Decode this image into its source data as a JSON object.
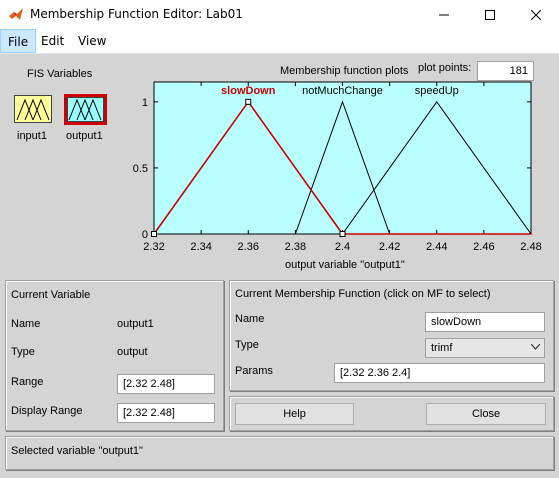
{
  "window": {
    "title": "Membership Function Editor: Lab01"
  },
  "menu": [
    {
      "label": "File"
    },
    {
      "label": "Edit"
    },
    {
      "label": "View"
    }
  ],
  "fis": {
    "heading": "FIS Variables",
    "input_label": "input1",
    "output_label": "output1"
  },
  "plot": {
    "title": "Membership function plots",
    "points_label": "plot points:",
    "points_value": "181",
    "xlabel": "output variable \"output1\"",
    "highlight_color": "#cc0000",
    "background_color": "#b9ffff"
  },
  "chart_data": {
    "type": "line",
    "xlim": [
      2.32,
      2.48
    ],
    "ylim": [
      0,
      1.15
    ],
    "x_ticks": [
      "2.32",
      "2.34",
      "2.36",
      "2.38",
      "2.4",
      "2.42",
      "2.44",
      "2.46",
      "2.48"
    ],
    "y_ticks": [
      "0",
      "0.5",
      "1"
    ],
    "series": [
      {
        "name": "slowDown",
        "x": [
          2.32,
          2.36,
          2.4
        ],
        "y": [
          0,
          1,
          0
        ],
        "selected": true
      },
      {
        "name": "notMuchChange",
        "x": [
          2.38,
          2.4,
          2.42
        ],
        "y": [
          0,
          1,
          0
        ],
        "selected": false
      },
      {
        "name": "speedUp",
        "x": [
          2.4,
          2.44,
          2.48
        ],
        "y": [
          0,
          1,
          0
        ],
        "selected": false
      }
    ]
  },
  "current_variable": {
    "heading": "Current Variable",
    "name_label": "Name",
    "name_value": "output1",
    "type_label": "Type",
    "type_value": "output",
    "range_label": "Range",
    "range_value": "[2.32 2.48]",
    "display_range_label": "Display Range",
    "display_range_value": "[2.32 2.48]"
  },
  "current_mf": {
    "heading": "Current Membership Function (click on MF to select)",
    "name_label": "Name",
    "name_value": "slowDown",
    "type_label": "Type",
    "type_value": "trimf",
    "params_label": "Params",
    "params_value": "[2.32 2.36 2.4]"
  },
  "buttons": {
    "help": "Help",
    "close": "Close"
  },
  "status": "Selected variable \"output1\""
}
